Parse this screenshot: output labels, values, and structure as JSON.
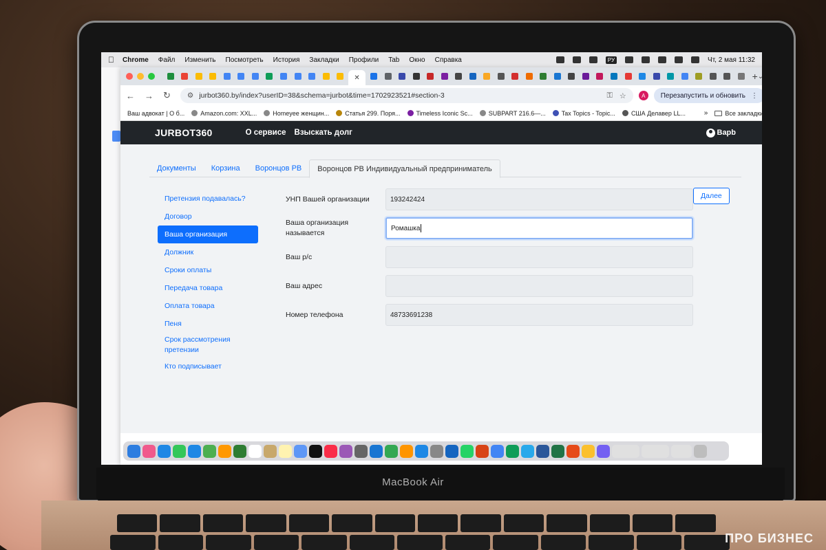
{
  "menubar": {
    "app": "Chrome",
    "items": [
      "Файл",
      "Изменить",
      "Посмотреть",
      "История",
      "Закладки",
      "Профили",
      "Tab",
      "Окно",
      "Справка"
    ],
    "input_source": "РУ",
    "datetime": "Чт, 2 мая  11:32"
  },
  "browser": {
    "url": "jurbot360.by/index?userID=38&schema=jurbot&time=1702923521#section-3",
    "profile_initial": "A",
    "update_button": "Перезапустить и обновить",
    "bookmarks": [
      "Ваш адвокат | О б...",
      "Amazon.com: XXL...",
      "Homeyee женщин...",
      "Статья 299. Поря...",
      "Timeless Iconic Sc...",
      "SUBPART 216.6—...",
      "Tax Topics - Topic...",
      "США Делавер LL..."
    ],
    "bookmarks_more": "»",
    "all_bookmarks": "Все закладки"
  },
  "site": {
    "logo": "JURBOT360",
    "nav": [
      "О сервисе",
      "Взыскать долг"
    ],
    "user": "Варb"
  },
  "tabs": [
    "Документы",
    "Корзина",
    "Воронцов РВ",
    "Воронцов РВ Индивидуальный предприниматель"
  ],
  "sidebar": {
    "items": [
      "Претензия подавалась?",
      "Договор",
      "Ваша организация",
      "Должник",
      "Сроки оплаты",
      "Передача товара",
      "Оплата товара",
      "Пеня",
      "Срок рассмотрения претензии",
      "Кто подписывает"
    ],
    "active_index": 2
  },
  "form": {
    "fields": [
      {
        "label": "УНП Вашей организации",
        "value": "193242424"
      },
      {
        "label": "Ваша организация называется",
        "value": "Ромашка"
      },
      {
        "label": "Ваш р/с",
        "value": ""
      },
      {
        "label": "Ваш адрес",
        "value": ""
      },
      {
        "label": "Номер телефона",
        "value": "48733691238"
      }
    ],
    "next_button": "Далее"
  },
  "laptop": {
    "model": "MacBook Air"
  },
  "watermark": "ПРО БИЗНЕС",
  "colors": {
    "accent": "#0d6efd",
    "header_bg": "#212529"
  }
}
